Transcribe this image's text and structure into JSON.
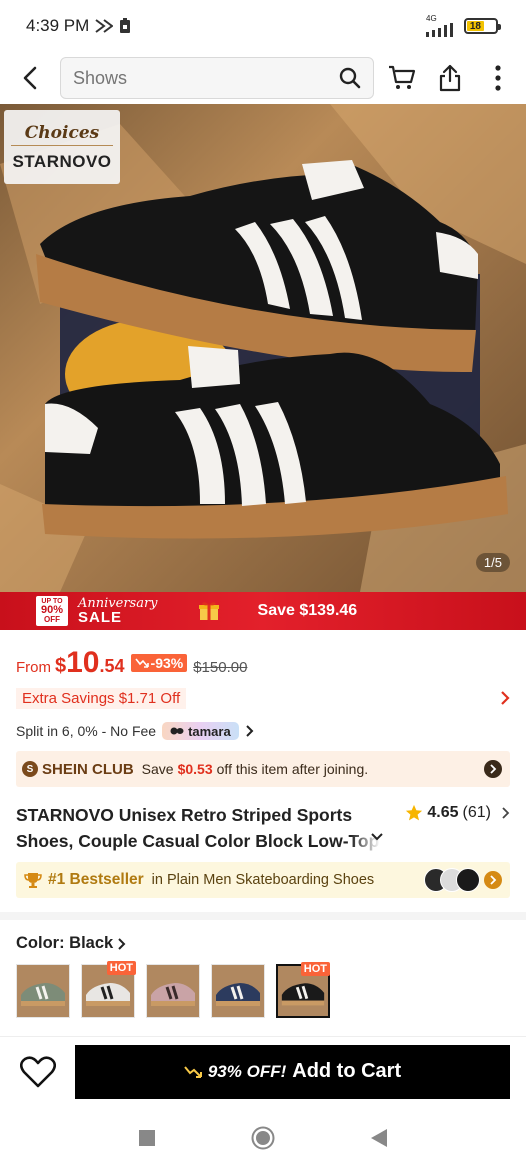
{
  "status_bar": {
    "time": "4:39 PM",
    "network": "4G",
    "battery": "18"
  },
  "search": {
    "placeholder": "Shows"
  },
  "hero": {
    "badge_top": "Choices",
    "badge_brand": "STARNOVO",
    "counter": "1/5"
  },
  "promo": {
    "tag_line1": "UP TO",
    "tag_line2": "90%",
    "tag_line3": "OFF",
    "anniversary": "Anniversary",
    "sale": "SALE",
    "save_text": "Save $139.46"
  },
  "price": {
    "from": "From",
    "currency": "$",
    "integer": "10",
    "decimal": ".54",
    "discount": "-93%",
    "original": "$150.00"
  },
  "extra_savings": "Extra Savings $1.71 Off",
  "split": {
    "text": "Split in 6, 0% - No Fee",
    "provider": "tamara"
  },
  "club": {
    "logo": "S",
    "name": "SHEIN CLUB",
    "save_prefix": "Save",
    "save_amount": "$0.53",
    "save_suffix": "off this item after joining."
  },
  "product": {
    "title": "STARNOVO Unisex Retro Striped Sports Shoes, Couple Casual Color Block Low-Top",
    "rating": "4.65",
    "reviews": "(61)"
  },
  "bestseller": {
    "rank": "#1 Bestseller",
    "category": "in Plain Men Skateboarding Shoes"
  },
  "color": {
    "label": "Color: Black",
    "hot_label": "HOT",
    "swatches": [
      {
        "name": "green",
        "color": "#7d8c78",
        "hot": false
      },
      {
        "name": "black-white",
        "color": "#e8e6e3",
        "hot": true
      },
      {
        "name": "pink",
        "color": "#c9a3a6",
        "hot": false
      },
      {
        "name": "navy",
        "color": "#2c3b5e",
        "hot": false
      },
      {
        "name": "black",
        "color": "#1a1a1a",
        "hot": true,
        "selected": true
      }
    ]
  },
  "cart": {
    "off_text": "93% OFF!",
    "label": "Add to Cart"
  },
  "colors": {
    "price_red": "#e0301e",
    "badge_orange": "#fa6338",
    "banner_red": "#d7141f",
    "club_bg": "#fdf0e5",
    "best_bg": "#fdf7de"
  }
}
